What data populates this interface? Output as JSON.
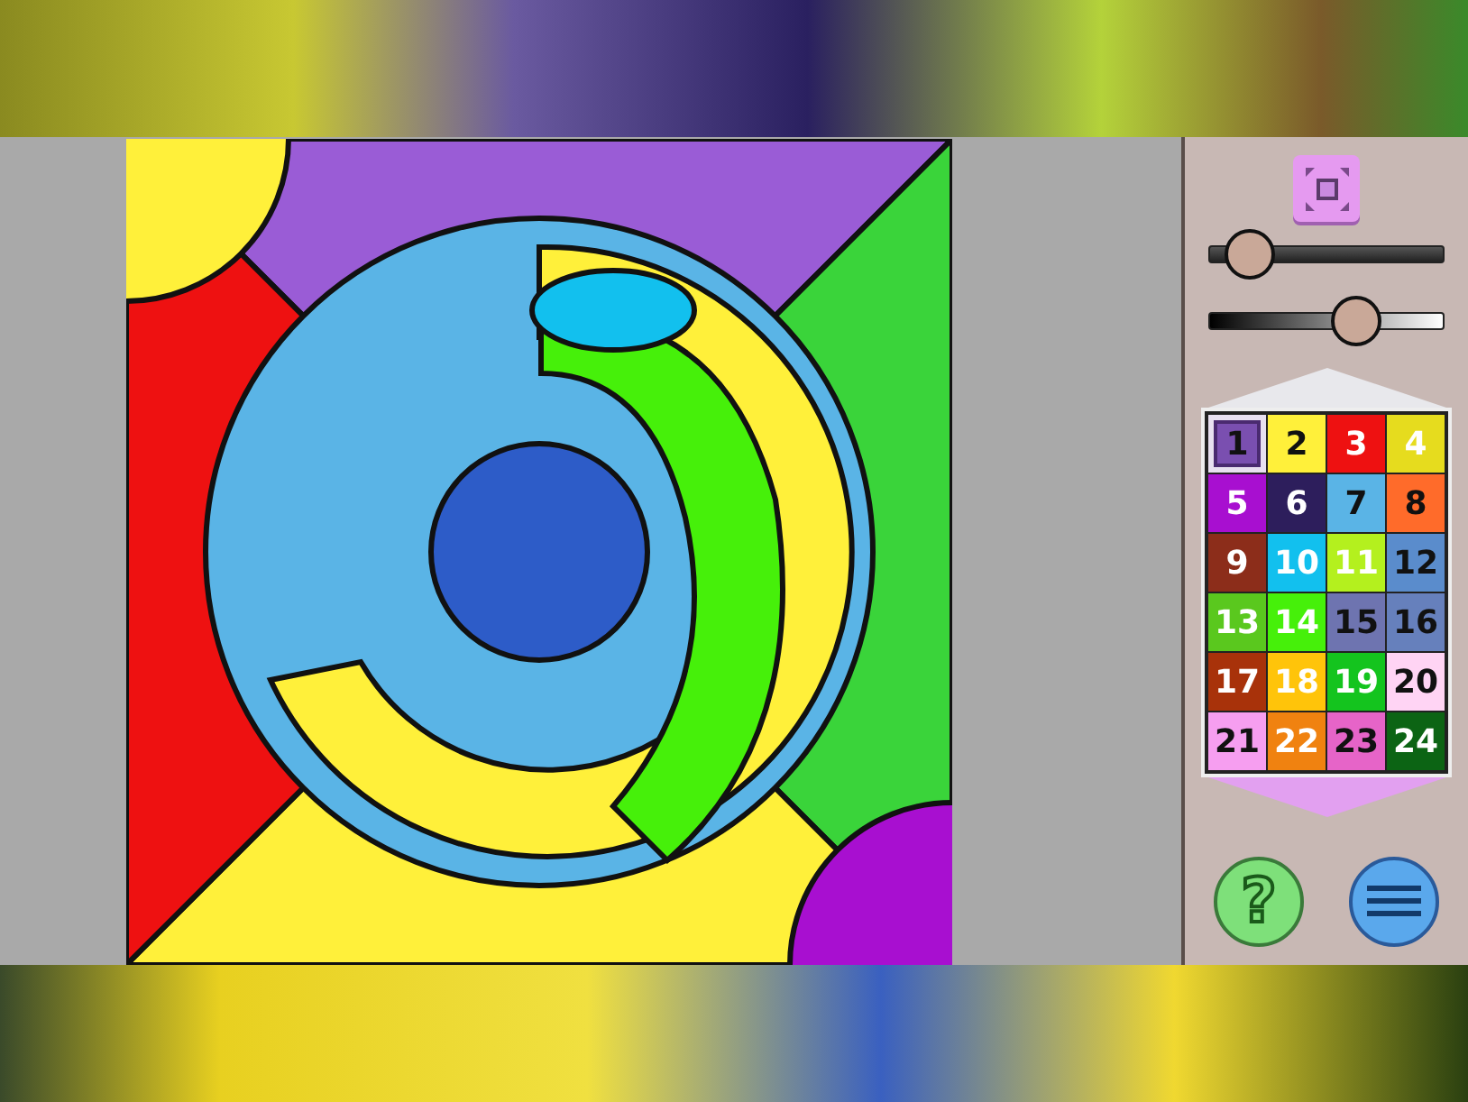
{
  "sliders": [
    {
      "kind": "dark",
      "level": 0.09
    },
    {
      "kind": "gradient",
      "level": 0.66
    }
  ],
  "palette": [
    {
      "label": "1",
      "color": "#7a4fb0",
      "light_label": false,
      "selected": true
    },
    {
      "label": "2",
      "color": "#fff03a",
      "light_label": false,
      "selected": false
    },
    {
      "label": "3",
      "color": "#ee1111",
      "light_label": true,
      "selected": false
    },
    {
      "label": "4",
      "color": "#e6dc1e",
      "light_label": true,
      "selected": false
    },
    {
      "label": "5",
      "color": "#a80fd0",
      "light_label": true,
      "selected": false
    },
    {
      "label": "6",
      "color": "#2d1e5c",
      "light_label": true,
      "selected": false
    },
    {
      "label": "7",
      "color": "#5ab4e6",
      "light_label": false,
      "selected": false
    },
    {
      "label": "8",
      "color": "#ff6b2a",
      "light_label": false,
      "selected": false
    },
    {
      "label": "9",
      "color": "#8c2d1a",
      "light_label": true,
      "selected": false
    },
    {
      "label": "10",
      "color": "#12c0ee",
      "light_label": true,
      "selected": false
    },
    {
      "label": "11",
      "color": "#b4f01e",
      "light_label": true,
      "selected": false
    },
    {
      "label": "12",
      "color": "#5a8ccc",
      "light_label": false,
      "selected": false
    },
    {
      "label": "13",
      "color": "#5ac81e",
      "light_label": true,
      "selected": false
    },
    {
      "label": "14",
      "color": "#46f00a",
      "light_label": true,
      "selected": false
    },
    {
      "label": "15",
      "color": "#6e74b0",
      "light_label": false,
      "selected": false
    },
    {
      "label": "16",
      "color": "#6680bc",
      "light_label": false,
      "selected": false
    },
    {
      "label": "17",
      "color": "#a8320a",
      "light_label": true,
      "selected": false
    },
    {
      "label": "18",
      "color": "#ffc40a",
      "light_label": true,
      "selected": false
    },
    {
      "label": "19",
      "color": "#14c41e",
      "light_label": true,
      "selected": false
    },
    {
      "label": "20",
      "color": "#ffd4f4",
      "light_label": false,
      "selected": false
    },
    {
      "label": "21",
      "color": "#f69ef0",
      "light_label": false,
      "selected": false
    },
    {
      "label": "22",
      "color": "#f08210",
      "light_label": true,
      "selected": false
    },
    {
      "label": "23",
      "color": "#e664c8",
      "light_label": false,
      "selected": false
    },
    {
      "label": "24",
      "color": "#0c6414",
      "light_label": true,
      "selected": false
    }
  ],
  "help_button": {
    "label": "?"
  }
}
